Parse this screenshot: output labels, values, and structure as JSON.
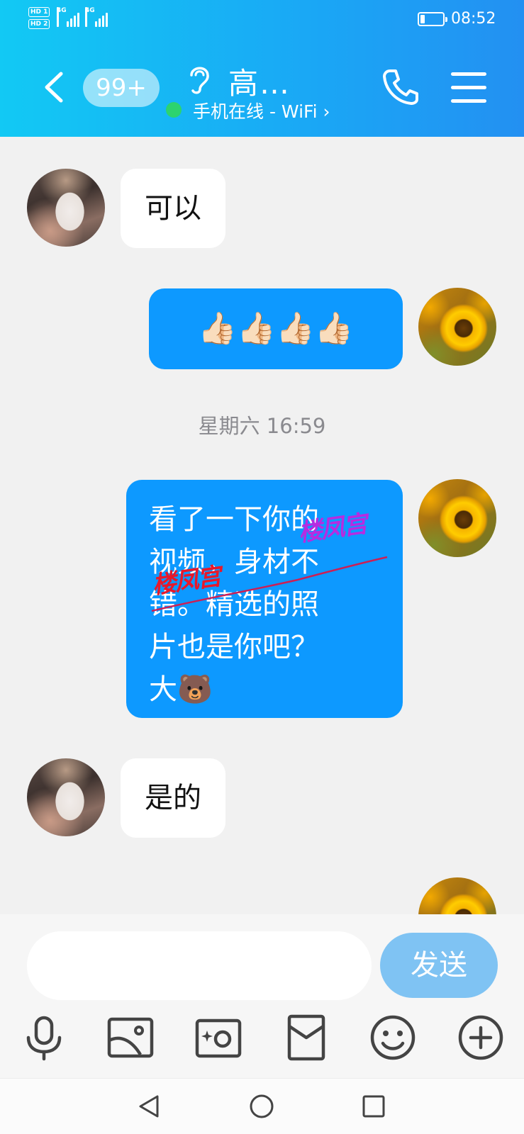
{
  "status_bar": {
    "sim1": "HD 1",
    "sim2": "HD 2",
    "net1": "4G",
    "net2": "4G",
    "time": "08:52"
  },
  "header": {
    "unread_badge": "99+",
    "contact_name": "高…",
    "online_status": "手机在线 - WiFi ›",
    "icons": [
      "back-icon",
      "ear-icon",
      "phone-icon",
      "menu-icon"
    ]
  },
  "messages": [
    {
      "side": "left",
      "text": "可以"
    },
    {
      "side": "right",
      "text": "👍🏻👍🏻👍🏻👍🏻"
    },
    {
      "type": "timestamp",
      "text": "星期六 16:59"
    },
    {
      "side": "right",
      "lines": [
        "看了一下你的",
        "视频，身材不",
        "错。精选的照",
        "片也是你吧？",
        "大🐻"
      ]
    },
    {
      "side": "left",
      "text": "是的"
    }
  ],
  "watermarks": {
    "a": "楼凤宫",
    "b": "楼凤宫"
  },
  "input": {
    "placeholder": "",
    "send_label": "发送"
  },
  "toolbar": [
    "microphone-icon",
    "image-icon",
    "camera-icon",
    "red-packet-icon",
    "emoji-icon",
    "plus-icon"
  ],
  "colors": {
    "header": "#12c9f4",
    "accent_bubble": "#0d99ff",
    "send": "#7fc3f3",
    "online": "#2dd36f"
  }
}
